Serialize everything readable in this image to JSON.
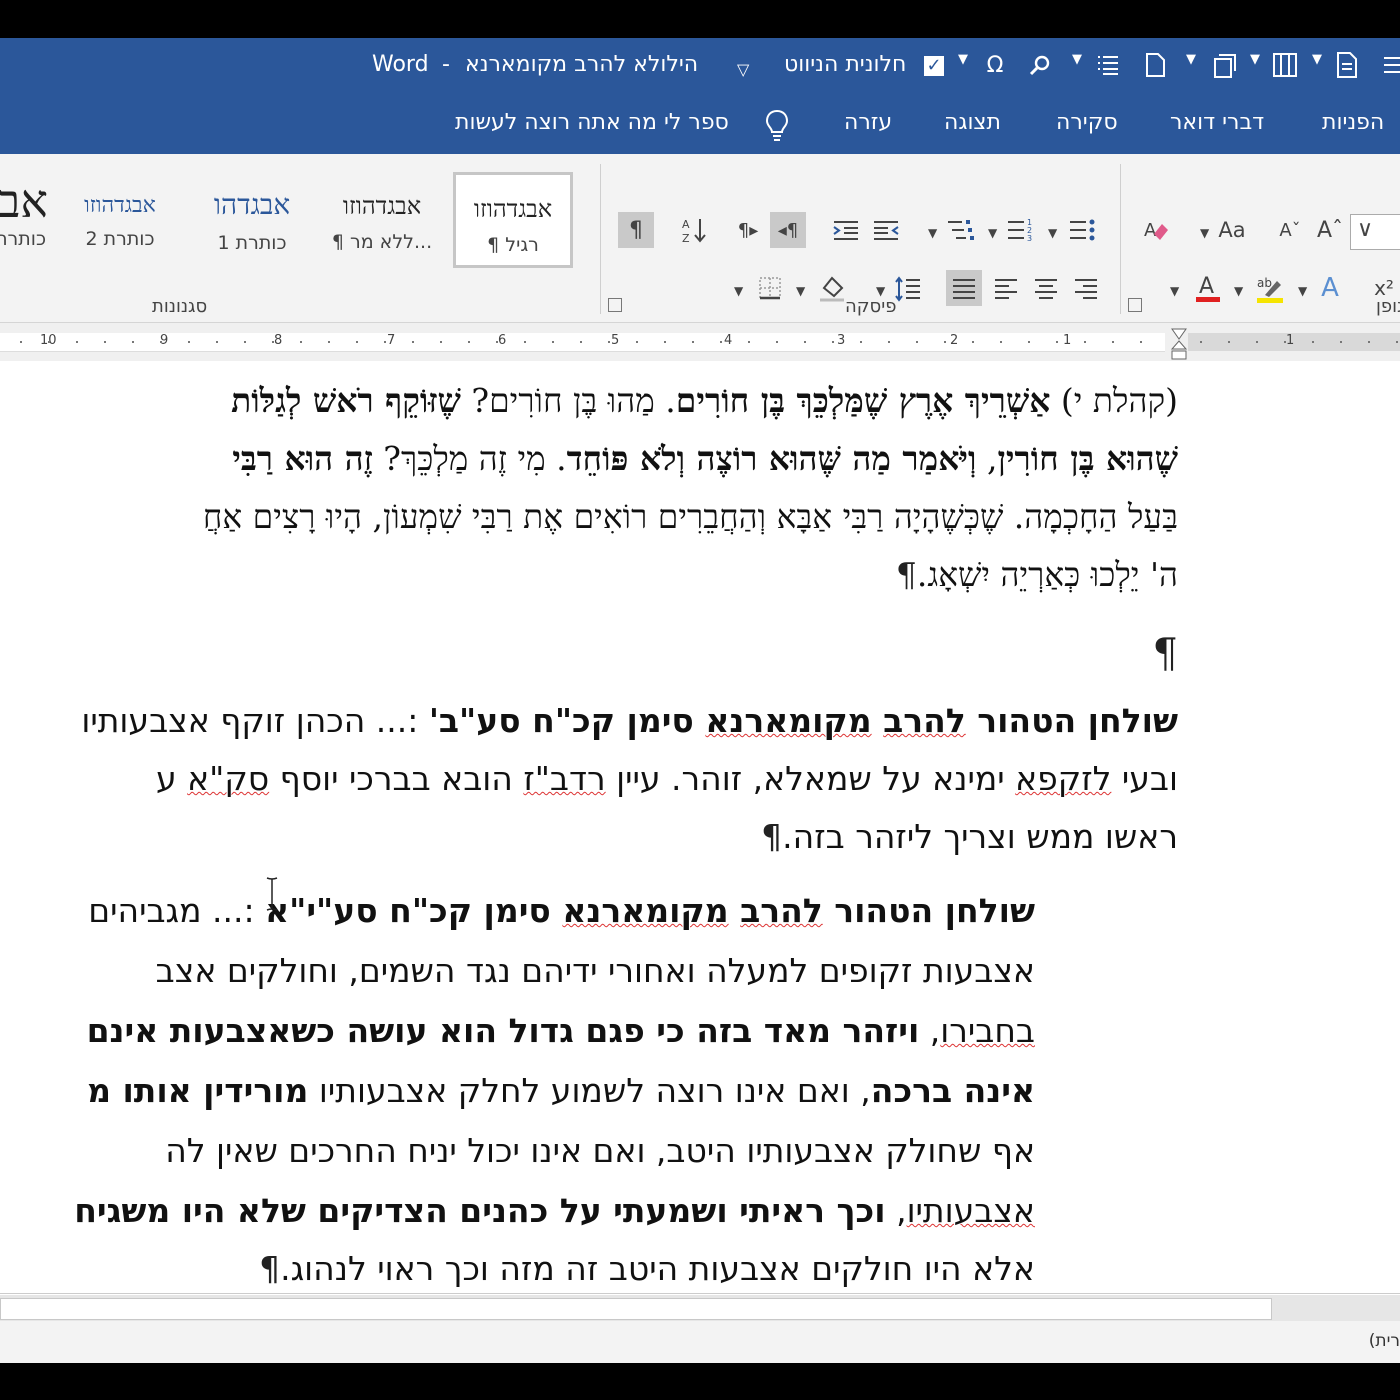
{
  "window": {
    "app_name": "Word",
    "title_separator": "-",
    "document_name": "הילולא להרב מקומארנא",
    "nav_pane_label": "חלונית הניווט",
    "nav_pane_checked": true
  },
  "tabs": [
    "הפניות",
    "דברי דואר",
    "סקירה",
    "תצוגה",
    "עזרה"
  ],
  "tell_me": "ספר לי מה אתה רוצה לעשות",
  "ribbon": {
    "groups": {
      "styles": "סגנונות",
      "paragraph": "פיסקה",
      "font_partial": "גופן"
    },
    "styles": [
      {
        "sample": "אבגדהוזו",
        "name": "¶ רגיל",
        "selected": true
      },
      {
        "sample": "אבגדהוזו",
        "name": "¶ ללא מר...",
        "selected": false
      },
      {
        "sample": "אבגדהו",
        "name": "כותרת 1",
        "selected": false
      },
      {
        "sample": "אבגדהוזו",
        "name": "כותרת 2",
        "selected": false
      },
      {
        "sample": "אב",
        "name": "כותרת",
        "selected": false
      }
    ],
    "font_size_button": "Aa",
    "superscript": "x²"
  },
  "ruler_numbers": [
    "1",
    "1",
    "2",
    "3",
    "4",
    "5",
    "6",
    "7",
    "8",
    "9",
    "10"
  ],
  "document": {
    "p1": {
      "l1": {
        "a": "(קהלת י) ",
        "b": "אַשְׁרֵיךְ אֶרֶץ שֶׁמַּלְכֵּךְ בֶּן חוֹרִים",
        "c": ". מַהוּ בֶּן חוֹרִים? ",
        "d": "שֶׁזּוֹקֵף רֹאשׁ לְגַלּוֹת"
      },
      "l2": {
        "a": "שֶׁהוּא בֶּן חוֹרִין",
        "b": ", ",
        "c": "וְיֹּאמַר מַה שֶּׁהוּא רוֹצֶה וְלֹא פּוֹחֵד",
        "d": ". מִי זֶה מַלְכֵּךְ? ",
        "e": "זֶה הוּא רַבִּי"
      },
      "l3": "בַּעַל הַחָכְמָה. שֶׁכְּשֶׁהָיָה רַבִּי אַבָּא וְהַחֲבֵרִים רוֹאִים אֶת רַבִּי שִׁמְעוֹן, הָיוּ רָצִים אַחֲ",
      "l4": "ה' יֵלְכוּ כְּאַרְיֵה יִשְׁאָג.",
      "pilcrow": "¶"
    },
    "p2": {
      "l1": {
        "a": "שולחן הטהור ",
        "b": "להרב",
        "c": " ",
        "d": "מקומארנא",
        "e": " סימן קכ\"ח סע\"ב'",
        "f": " :... הכהן זוקף אצבעותיו"
      },
      "l2": {
        "a": "ובעי ",
        "b": "לזקפא",
        "c": " ימינא על שמאלא, זוהר. עיין ",
        "d": "רדב\"ז",
        "e": " הובא בברכי יוסף ",
        "f": "סק\"א",
        "g": " ע"
      },
      "l3": "ראשו ממש וצריך ליזהר בזה."
    },
    "p3": {
      "l1": {
        "a": "שולחן הטהור ",
        "b": "להרב",
        "c": " ",
        "d": "מקומארנא",
        "e": " סימן קכ\"ח סע\"י\"א",
        "f": " :... מגביהים"
      },
      "l2": "אצבעות זקופים למעלה ואחורי ידיהם נגד השמים, וחולקים אצב",
      "l3": {
        "a": "בחבירו",
        "b": ", ",
        "c": "ויזהר מאד בזה כי פגם גדול הוא עושה כשאצבעות אינם"
      },
      "l4": {
        "a": "אינה ברכה",
        "b": ", ואם אינו רוצה לשמוע לחלק אצבעותיו ",
        "c": "מורידין אותו מ"
      },
      "l5": "אף שחולק אצבעותיו היטב, ואם אינו יכול יניח החרכים שאין לה",
      "l6": {
        "a": "אצבעותיו",
        "b": ", ",
        "c": "וכך ראיתי ושמעתי על כהנים הצדיקים שלא היו משגיח"
      },
      "l7": "אלא היו חולקים אצבעות היטב זה מזה וכך ראוי לנהוג."
    }
  },
  "status_bar": {
    "language_partial": "(רית"
  },
  "colors": {
    "ribbon_blue": "#2b579a",
    "font_red": "#e02020",
    "highlight_yellow": "#f5e400",
    "squiggle_red": "#d33333"
  },
  "icons": [
    "pilcrow-icon",
    "sort-icon",
    "ltr-icon",
    "rtl-icon",
    "indent-icon",
    "outdent-icon",
    "multilevel-list-icon",
    "numbering-icon",
    "bullets-icon",
    "borders-icon",
    "shading-icon",
    "line-spacing-icon",
    "justify-icon",
    "align-left-icon",
    "center-icon",
    "align-right-icon",
    "clear-format-icon",
    "change-case-icon",
    "shrink-font-icon",
    "grow-font-icon",
    "font-color-icon",
    "highlight-icon",
    "text-effects-icon",
    "superscript-icon",
    "omega-icon",
    "search-icon",
    "lightbulb-icon",
    "ibeam-cursor-icon"
  ]
}
